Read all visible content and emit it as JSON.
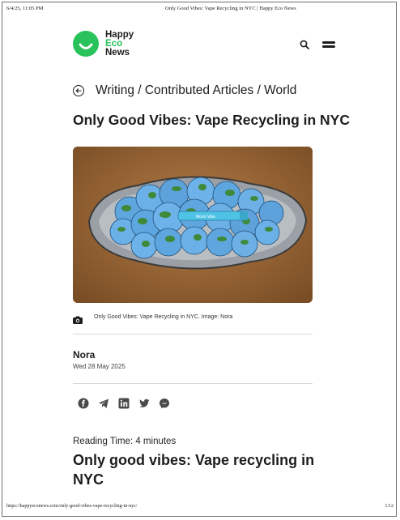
{
  "print_header": {
    "datetime": "6/4/25, 11:05 PM",
    "title": "Only Good Vibes: Vape Recycling in NYC | Happy Eco News"
  },
  "logo": {
    "line1": "Happy",
    "line2": "Eco",
    "line3": "News",
    "brand_color": "#29c25b"
  },
  "breadcrumb": {
    "text": "Writing / Contributed Articles / World"
  },
  "article": {
    "title": "Only Good Vibes: Vape Recycling in NYC",
    "image_caption": "Only Good Vibes: Vape Recycling in NYC. Image: Nora",
    "image_vape_label": "Moon Vibe",
    "author": "Nora",
    "date": "Wed 28 May 2025",
    "reading_time": "Reading Time: 4 minutes",
    "heading": "Only good vibes: Vape recycling in NYC"
  },
  "share_icons": [
    "facebook-icon",
    "telegram-icon",
    "linkedin-icon",
    "twitter-icon",
    "messenger-icon"
  ],
  "print_footer": {
    "url": "https://happyeconews.com/only-good-vibes-vape-recycling-in-nyc/",
    "page": "1/12"
  }
}
